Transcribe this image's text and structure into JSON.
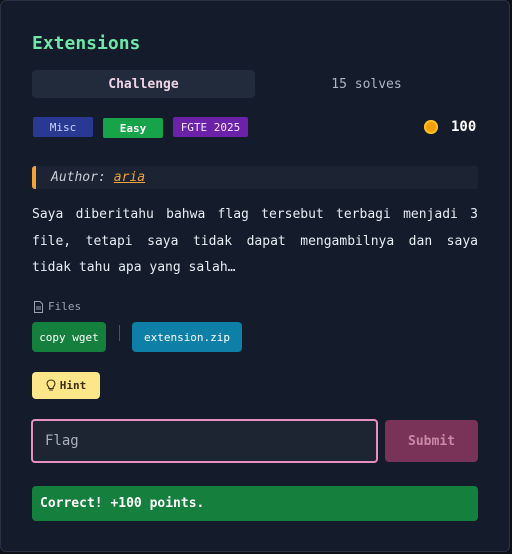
{
  "challenge": {
    "title": "Extensions",
    "tabs": [
      {
        "label": "Challenge",
        "active": true
      },
      {
        "label": "15 solves",
        "active": false
      }
    ],
    "tags": [
      "Misc",
      "Easy",
      "FGTE 2025"
    ],
    "points": "100",
    "author_label": "Author:",
    "author_name": "aria",
    "description": "Saya diberitahu bahwa flag tersebut terbagi menjadi 3 file, tetapi saya tidak dapat mengambilnya dan saya tidak tahu apa yang salah…",
    "files_label": "Files",
    "files": {
      "wget_label": "copy wget",
      "zip_label": "extension.zip"
    },
    "hint_label": "Hint",
    "flag_placeholder": "Flag",
    "submit_label": "Submit",
    "result_message": "Correct! +100 points."
  },
  "colors": {
    "title": "#6ee7a8",
    "misc": "#283893",
    "easy": "#17a34a",
    "fgte": "#6b21a8",
    "success": "#15803d",
    "input_border": "#e88fc1"
  },
  "icons": [
    "coin-icon",
    "file-icon",
    "lightbulb-icon"
  ]
}
